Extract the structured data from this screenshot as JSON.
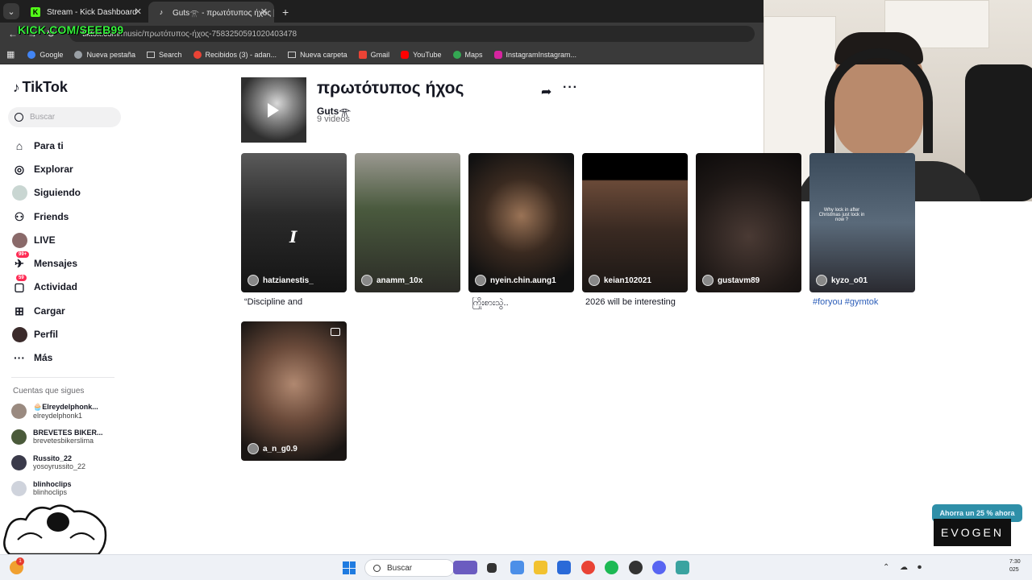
{
  "browser": {
    "tabs": [
      {
        "label": "Stream - Kick Dashboard",
        "favicon": "K"
      },
      {
        "label": "Guts𓁿 - πρωτότυπος ήχος | Ti",
        "favicon": "♪"
      }
    ],
    "url_domain": "tiktok.com",
    "url_path": "/music/πρωτότυπος-ήχος-7583250591020403478",
    "bookmarks": [
      "Google",
      "Nueva pestaña",
      "Search",
      "Recibidos (3) - adan...",
      "Nueva carpeta",
      "Gmail",
      "YouTube",
      "Maps",
      "InstagramInstagram..."
    ]
  },
  "overlay": {
    "kick_url": "KICK.COM/SEEB99",
    "promo": "Ahorra un 25 % ahora",
    "brand": "EVOGEN"
  },
  "sidebar": {
    "logo": "TikTok",
    "search_placeholder": "Buscar",
    "nav": [
      {
        "label": "Para ti",
        "icon": "home-icon"
      },
      {
        "label": "Explorar",
        "icon": "compass-icon"
      },
      {
        "label": "Siguiendo",
        "icon": "following-avatar-icon"
      },
      {
        "label": "Friends",
        "icon": "friends-icon"
      },
      {
        "label": "LIVE",
        "icon": "live-avatar-icon"
      },
      {
        "label": "Mensajes",
        "icon": "messages-icon",
        "badge": "99+"
      },
      {
        "label": "Actividad",
        "icon": "activity-icon",
        "badge": "59"
      },
      {
        "label": "Cargar",
        "icon": "upload-icon"
      },
      {
        "label": "Perfil",
        "icon": "profile-icon"
      },
      {
        "label": "Más",
        "icon": "more-dots-icon"
      }
    ],
    "following_title": "Cuentas que sigues",
    "following": [
      {
        "name": "🧁Elreydelphonk...",
        "handle": "elreydelphonk1"
      },
      {
        "name": "BREVETES BIKER...",
        "handle": "brevetesbikerslima"
      },
      {
        "name": "Russito_22",
        "handle": "yosoyrussito_22"
      },
      {
        "name": "blinhoclips",
        "handle": "blinhoclips"
      }
    ]
  },
  "music": {
    "title": "πρωτότυπος ήχος",
    "artist": "Guts𓁿",
    "video_count": "9 videos"
  },
  "videos": [
    {
      "user": "hatzianestis_",
      "caption": "“Discipline and"
    },
    {
      "user": "anamm_10x",
      "caption": ""
    },
    {
      "user": "nyein.chin.aung1",
      "caption": "ကြိုးစားသွဲ.."
    },
    {
      "user": "keian102021",
      "caption": "2026 will be interesting"
    },
    {
      "user": "gustavm89",
      "caption": ""
    },
    {
      "user": "kyzo_o01",
      "caption": "#foryou #gymtok"
    },
    {
      "user": "a_n_g0.9",
      "caption": ""
    }
  ],
  "taskbar": {
    "search_label": "Buscar",
    "time": "7:30",
    "year_fragment": "025"
  }
}
